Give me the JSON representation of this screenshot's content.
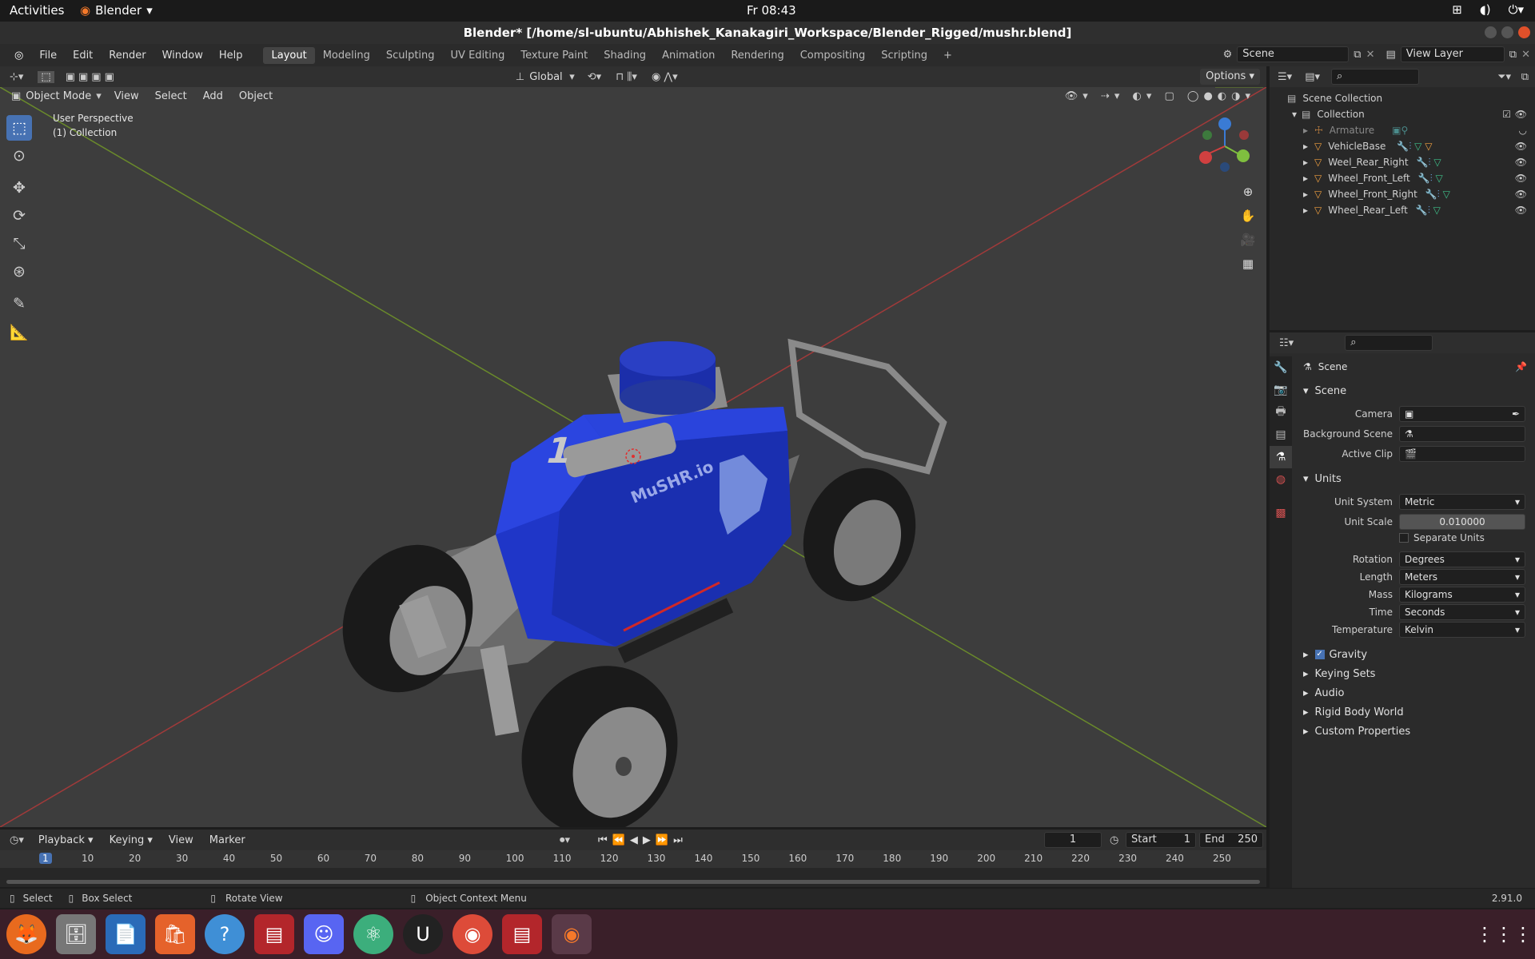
{
  "topbar": {
    "activities": "Activities",
    "app": "Blender",
    "clock": "Fr 08:43"
  },
  "window": {
    "title": "Blender* [/home/sl-ubuntu/Abhishek_Kanakagiri_Workspace/Blender_Rigged/mushr.blend]"
  },
  "menu": [
    "File",
    "Edit",
    "Render",
    "Window",
    "Help"
  ],
  "workspaces": [
    "Layout",
    "Modeling",
    "Sculpting",
    "UV Editing",
    "Texture Paint",
    "Shading",
    "Animation",
    "Rendering",
    "Compositing",
    "Scripting"
  ],
  "scene_field": "Scene",
  "view_layer": "View Layer",
  "viewport_header": {
    "transform": "Global",
    "options": "Options"
  },
  "viewport_header2": {
    "mode": "Object Mode",
    "menus": [
      "View",
      "Select",
      "Add",
      "Object"
    ]
  },
  "viewport": {
    "perspective": "User Perspective",
    "collection": "(1) Collection",
    "decal_number": "1",
    "decal_text": "MuSHR.io"
  },
  "outliner": {
    "root": "Scene Collection",
    "collection": "Collection",
    "items": [
      "Armature",
      "VehicleBase",
      "Weel_Rear_Right",
      "Wheel_Front_Left",
      "Wheel_Front_Right",
      "Wheel_Rear_Left"
    ]
  },
  "properties": {
    "header": "Scene",
    "scene_section": "Scene",
    "camera_label": "Camera",
    "background_label": "Background Scene",
    "clip_label": "Active Clip",
    "units_section": "Units",
    "unit_system_label": "Unit System",
    "unit_system": "Metric",
    "unit_scale_label": "Unit Scale",
    "unit_scale": "0.010000",
    "separate_units": "Separate Units",
    "rotation_label": "Rotation",
    "rotation": "Degrees",
    "length_label": "Length",
    "length": "Meters",
    "mass_label": "Mass",
    "mass": "Kilograms",
    "time_label": "Time",
    "time": "Seconds",
    "temperature_label": "Temperature",
    "temperature": "Kelvin",
    "collapsed": [
      "Gravity",
      "Keying Sets",
      "Audio",
      "Rigid Body World",
      "Custom Properties"
    ]
  },
  "timeline": {
    "menus": [
      "Playback",
      "Keying",
      "View",
      "Marker"
    ],
    "current": "1",
    "start_label": "Start",
    "start": "1",
    "end_label": "End",
    "end": "250",
    "ticks": [
      "1",
      "10",
      "20",
      "30",
      "40",
      "50",
      "60",
      "70",
      "80",
      "90",
      "100",
      "110",
      "120",
      "130",
      "140",
      "150",
      "160",
      "170",
      "180",
      "190",
      "200",
      "210",
      "220",
      "230",
      "240",
      "250"
    ]
  },
  "status": {
    "select": "Select",
    "box_select": "Box Select",
    "rotate": "Rotate View",
    "context": "Object Context Menu",
    "version": "2.91.0"
  },
  "colors": {
    "accent": "#4772b3",
    "car_body": "#1f36c8",
    "axis_x": "#c0392b",
    "axis_y": "#7fa82a"
  }
}
